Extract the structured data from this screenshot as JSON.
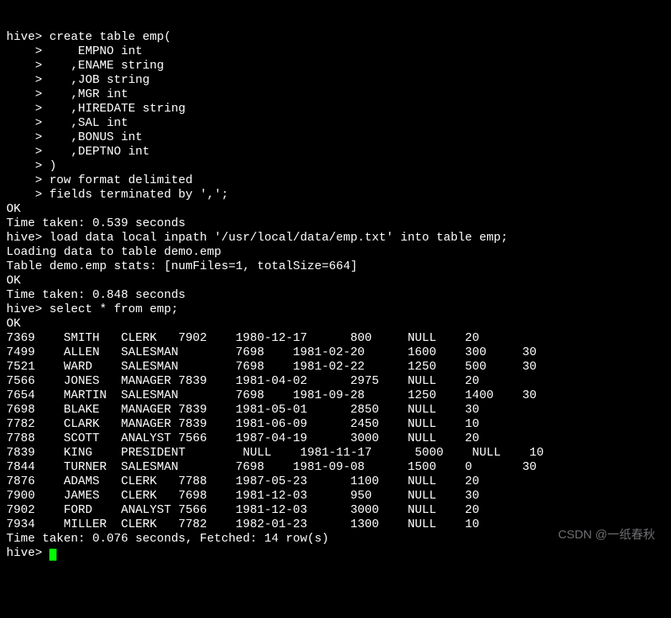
{
  "top_cutoff": "",
  "prompt": "hive>",
  "cont_prompt": "    >",
  "create_table": [
    " create table emp(",
    "     EMPNO int",
    "    ,ENAME string",
    "    ,JOB string",
    "    ,MGR int",
    "    ,HIREDATE string",
    "    ,SAL int",
    "    ,BONUS int",
    "    ,DEPTNO int",
    " )",
    " row format delimited",
    " fields terminated by ',';"
  ],
  "ok": "OK",
  "time1": "Time taken: 0.539 seconds",
  "load_cmd": " load data local inpath '/usr/local/data/emp.txt' into table emp;",
  "loading": "Loading data to table demo.emp",
  "stats": "Table demo.emp stats: [numFiles=1, totalSize=664]",
  "time2": "Time taken: 0.848 seconds",
  "select_cmd": " select * from emp;",
  "chart_data": {
    "type": "table",
    "columns": [
      "EMPNO",
      "ENAME",
      "JOB",
      "MGR",
      "HIREDATE",
      "SAL",
      "BONUS",
      "DEPTNO"
    ],
    "rows": [
      {
        "empno": "7369",
        "ename": "SMITH",
        "job": "CLERK",
        "mgr": "7902",
        "hiredate": "1980-12-17",
        "sal": "800",
        "bonus": "NULL",
        "deptno": "20"
      },
      {
        "empno": "7499",
        "ename": "ALLEN",
        "job": "SALESMAN",
        "mgr": "7698",
        "hiredate": "1981-02-20",
        "sal": "1600",
        "bonus": "300",
        "deptno": "30"
      },
      {
        "empno": "7521",
        "ename": "WARD",
        "job": "SALESMAN",
        "mgr": "7698",
        "hiredate": "1981-02-22",
        "sal": "1250",
        "bonus": "500",
        "deptno": "30"
      },
      {
        "empno": "7566",
        "ename": "JONES",
        "job": "MANAGER",
        "mgr": "7839",
        "hiredate": "1981-04-02",
        "sal": "2975",
        "bonus": "NULL",
        "deptno": "20"
      },
      {
        "empno": "7654",
        "ename": "MARTIN",
        "job": "SALESMAN",
        "mgr": "7698",
        "hiredate": "1981-09-28",
        "sal": "1250",
        "bonus": "1400",
        "deptno": "30"
      },
      {
        "empno": "7698",
        "ename": "BLAKE",
        "job": "MANAGER",
        "mgr": "7839",
        "hiredate": "1981-05-01",
        "sal": "2850",
        "bonus": "NULL",
        "deptno": "30"
      },
      {
        "empno": "7782",
        "ename": "CLARK",
        "job": "MANAGER",
        "mgr": "7839",
        "hiredate": "1981-06-09",
        "sal": "2450",
        "bonus": "NULL",
        "deptno": "10"
      },
      {
        "empno": "7788",
        "ename": "SCOTT",
        "job": "ANALYST",
        "mgr": "7566",
        "hiredate": "1987-04-19",
        "sal": "3000",
        "bonus": "NULL",
        "deptno": "20"
      },
      {
        "empno": "7839",
        "ename": "KING",
        "job": "PRESIDENT",
        "mgr": "NULL",
        "hiredate": "1981-11-17",
        "sal": "5000",
        "bonus": "NULL",
        "deptno": "10"
      },
      {
        "empno": "7844",
        "ename": "TURNER",
        "job": "SALESMAN",
        "mgr": "7698",
        "hiredate": "1981-09-08",
        "sal": "1500",
        "bonus": "0",
        "deptno": "30"
      },
      {
        "empno": "7876",
        "ename": "ADAMS",
        "job": "CLERK",
        "mgr": "7788",
        "hiredate": "1987-05-23",
        "sal": "1100",
        "bonus": "NULL",
        "deptno": "20"
      },
      {
        "empno": "7900",
        "ename": "JAMES",
        "job": "CLERK",
        "mgr": "7698",
        "hiredate": "1981-12-03",
        "sal": "950",
        "bonus": "NULL",
        "deptno": "30"
      },
      {
        "empno": "7902",
        "ename": "FORD",
        "job": "ANALYST",
        "mgr": "7566",
        "hiredate": "1981-12-03",
        "sal": "3000",
        "bonus": "NULL",
        "deptno": "20"
      },
      {
        "empno": "7934",
        "ename": "MILLER",
        "job": "CLERK",
        "mgr": "7782",
        "hiredate": "1982-01-23",
        "sal": "1300",
        "bonus": "NULL",
        "deptno": "10"
      }
    ]
  },
  "time3": "Time taken: 0.076 seconds, Fetched: 14 row(s)",
  "watermark": "CSDN @一纸春秋"
}
